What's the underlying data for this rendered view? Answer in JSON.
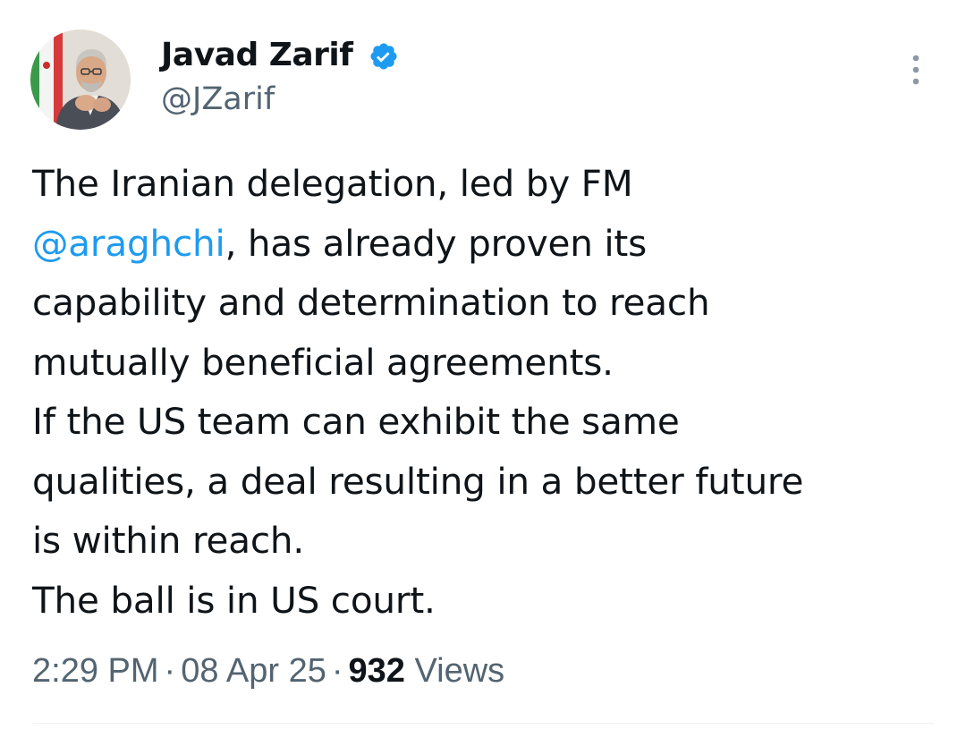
{
  "author": {
    "display_name": "Javad Zarif",
    "handle": "@JZarif",
    "verified": true,
    "verified_icon": "verified-badge-icon"
  },
  "tweet": {
    "lines": [
      {
        "text": "The Iranian delegation, led by FM"
      },
      {
        "mention": "@araghchi",
        "text": ", has already proven its"
      },
      {
        "text": "capability and determination to reach"
      },
      {
        "text": "mutually beneficial agreements."
      },
      {
        "text": "If the US team can exhibit the same"
      },
      {
        "text": "qualities, a deal resulting in a better future"
      },
      {
        "text": "is within reach."
      },
      {
        "text": "The ball is in US court."
      }
    ]
  },
  "meta": {
    "time": "2:29 PM",
    "separator": "·",
    "date": "08 Apr 25",
    "views_count": "932",
    "views_label": "Views"
  },
  "colors": {
    "text": "#0f1419",
    "secondary": "#536471",
    "accent": "#1d9bf0",
    "divider": "#eff3f4"
  },
  "icons": {
    "more": "more-vertical-icon"
  }
}
